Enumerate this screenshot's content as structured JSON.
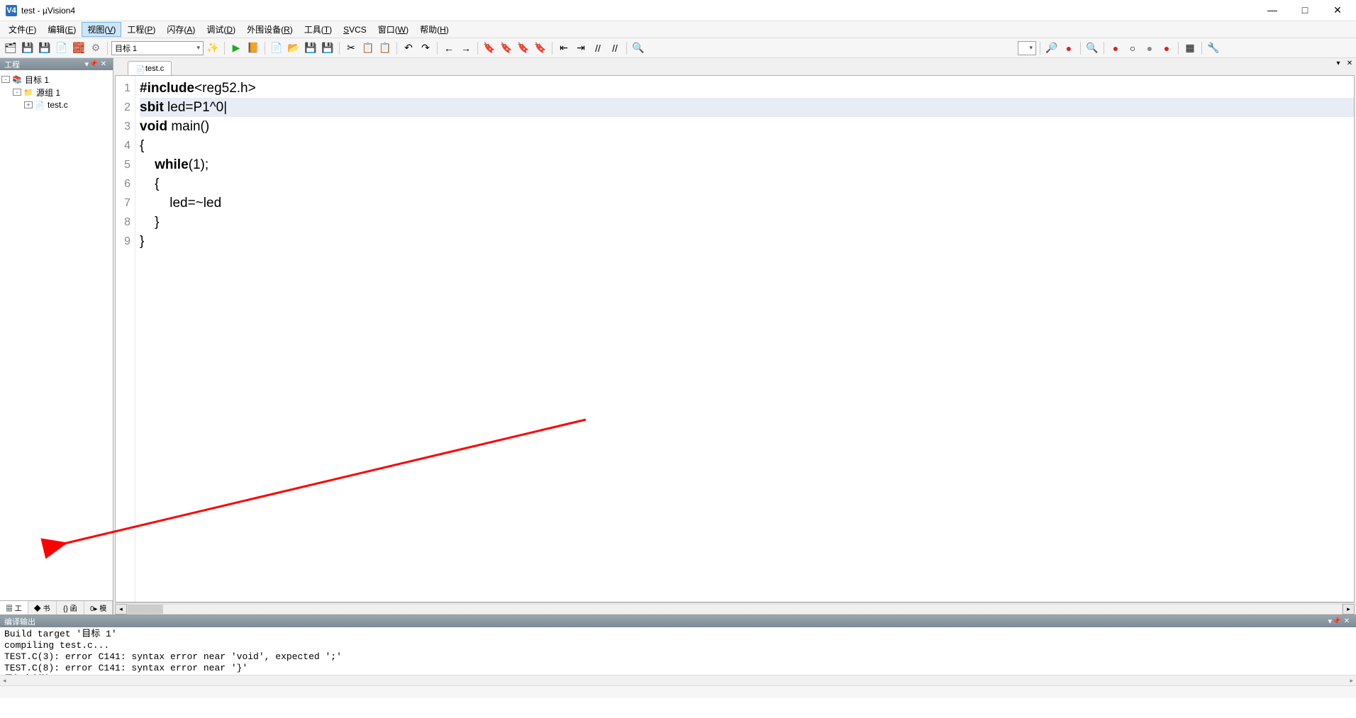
{
  "window": {
    "app_icon_text": "V4",
    "title": "test  - µVision4",
    "controls": {
      "min": "—",
      "max": "□",
      "close": "✕"
    }
  },
  "menubar": {
    "items": [
      {
        "label": "文件(F)",
        "key": "F"
      },
      {
        "label": "编辑(E)",
        "key": "E"
      },
      {
        "label": "视图(V)",
        "key": "V",
        "active": true
      },
      {
        "label": "工程(P)",
        "key": "P"
      },
      {
        "label": "闪存(A)",
        "key": "A"
      },
      {
        "label": "调试(D)",
        "key": "D"
      },
      {
        "label": "外围设备(R)",
        "key": "R"
      },
      {
        "label": "工具(T)",
        "key": "T"
      },
      {
        "label": "SVCS",
        "key": "S"
      },
      {
        "label": "窗口(W)",
        "key": "W"
      },
      {
        "label": "帮助(H)",
        "key": "H"
      }
    ]
  },
  "toolbar1": {
    "target_label": "目标 1",
    "icons": [
      "folder-multi",
      "disk-multi",
      "disk",
      "page",
      "brick",
      "gear-sep",
      "target-combo",
      "wand",
      "sep",
      "run-green",
      "book-yellow",
      "sep",
      "new-page",
      "open-folder",
      "save",
      "save-all",
      "sep",
      "cut",
      "copy",
      "paste",
      "sep",
      "undo",
      "redo",
      "sep",
      "nav-back",
      "nav-fwd",
      "sep",
      "bookmark-toggle",
      "bookmark-prev",
      "bookmark-next",
      "bookmark-clear",
      "sep",
      "indent-dec",
      "indent-inc",
      "comment",
      "uncomment",
      "sep",
      "find-folder",
      "sep-wide",
      "find-combo",
      "sep",
      "debug-start",
      "breakpoint-ins",
      "sep",
      "zoom-lens",
      "sep",
      "rec-red",
      "rec-stop",
      "rec-gray",
      "rec-red2",
      "sep",
      "window-config",
      "sep",
      "tools"
    ]
  },
  "project_panel": {
    "title": "工程",
    "tree": [
      {
        "depth": 0,
        "expander": "-",
        "icon": "root",
        "label": "目标 1"
      },
      {
        "depth": 1,
        "expander": "-",
        "icon": "folder",
        "label": "源组 1"
      },
      {
        "depth": 2,
        "expander": "+",
        "icon": "file",
        "label": "test.c"
      }
    ],
    "tabs": [
      {
        "label": "工",
        "icon": "proj",
        "active": true
      },
      {
        "label": "书",
        "icon": "book"
      },
      {
        "label": "函",
        "icon": "func"
      },
      {
        "label": "模",
        "icon": "tmpl"
      }
    ]
  },
  "editor": {
    "tab": {
      "filename": "test.c"
    },
    "code_lines": [
      {
        "n": 1,
        "raw": "#include<reg52.h>",
        "segments": [
          {
            "t": "#include",
            "c": "kw"
          },
          {
            "t": "<reg52.h>",
            "c": ""
          }
        ]
      },
      {
        "n": 2,
        "raw": "sbit led=P1^0",
        "active": true,
        "segments": [
          {
            "t": "sbit",
            "c": "kw"
          },
          {
            "t": " led=P1^",
            "c": ""
          },
          {
            "t": "0",
            "c": "num"
          }
        ],
        "caret_after": true
      },
      {
        "n": 3,
        "raw": "void main()",
        "segments": [
          {
            "t": "void",
            "c": "kw"
          },
          {
            "t": " main()",
            "c": ""
          }
        ]
      },
      {
        "n": 4,
        "raw": "{",
        "segments": [
          {
            "t": "{",
            "c": ""
          }
        ]
      },
      {
        "n": 5,
        "raw": "    while(1);",
        "segments": [
          {
            "t": "    ",
            "c": ""
          },
          {
            "t": "while",
            "c": "kw"
          },
          {
            "t": "(",
            "c": ""
          },
          {
            "t": "1",
            "c": "num"
          },
          {
            "t": ");",
            "c": ""
          }
        ]
      },
      {
        "n": 6,
        "raw": "    {",
        "segments": [
          {
            "t": "    {",
            "c": ""
          }
        ]
      },
      {
        "n": 7,
        "raw": "        led=~led",
        "segments": [
          {
            "t": "        led=~led",
            "c": ""
          }
        ]
      },
      {
        "n": 8,
        "raw": "    }",
        "segments": [
          {
            "t": "    }",
            "c": ""
          }
        ]
      },
      {
        "n": 9,
        "raw": "}",
        "segments": [
          {
            "t": "}",
            "c": ""
          }
        ]
      }
    ]
  },
  "output_panel": {
    "title": "编译输出",
    "lines": [
      "Build target '目标 1'",
      "compiling test.c...",
      "TEST.C(3): error C141: syntax error near 'void', expected ';'",
      "TEST.C(8): error C141: syntax error near '}'",
      "目标未创建"
    ]
  },
  "icons": {
    "folder-multi": "🗂",
    "disk-multi": "💾",
    "disk": "💾",
    "page": "📄",
    "brick": "🧱",
    "wand": "✨",
    "run-green": "▶",
    "book-yellow": "📙",
    "new-page": "📄",
    "open-folder": "📂",
    "save": "💾",
    "save-all": "💾",
    "cut": "✂",
    "copy": "📋",
    "paste": "📋",
    "undo": "↶",
    "redo": "↷",
    "nav-back": "←",
    "nav-fwd": "→",
    "bookmark-toggle": "🔖",
    "bookmark-prev": "🔖",
    "bookmark-next": "🔖",
    "bookmark-clear": "🔖",
    "indent-dec": "⇤",
    "indent-inc": "⇥",
    "comment": "//",
    "uncomment": "//",
    "find-folder": "🔍",
    "debug-start": "🔎",
    "breakpoint-ins": "●",
    "zoom-lens": "🔍",
    "rec-red": "●",
    "rec-stop": "○",
    "rec-gray": "●",
    "rec-red2": "●",
    "window-config": "▦",
    "tools": "🔧",
    "gear-sep": "⚙"
  }
}
